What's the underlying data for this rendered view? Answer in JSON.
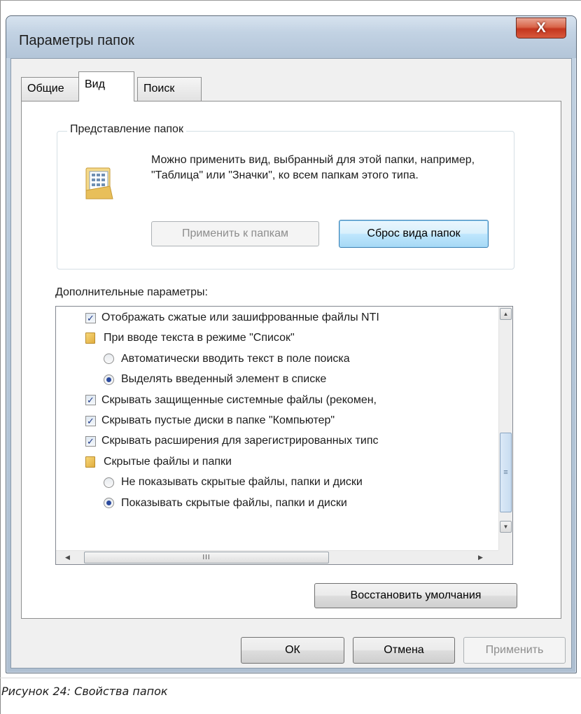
{
  "window": {
    "title": "Параметры папок",
    "close_glyph": "X"
  },
  "tabs": [
    {
      "label": "Общие",
      "active": false
    },
    {
      "label": "Вид",
      "active": true
    },
    {
      "label": "Поиск",
      "active": false
    }
  ],
  "folder_views": {
    "group_title": "Представление папок",
    "description": "Можно применить вид, выбранный для этой папки, например, \"Таблица\" или \"Значки\", ко всем папкам этого типа.",
    "apply_button": "Применить к папкам",
    "reset_button": "Сброс вида папок",
    "icon": "folder-view-icon"
  },
  "advanced": {
    "label": "Дополнительные параметры:",
    "items": [
      {
        "type": "checkbox",
        "checked": true,
        "indent": 0,
        "text": "Отображать сжатые или зашифрованные файлы NTI"
      },
      {
        "type": "folder",
        "indent": 0,
        "text": "При вводе текста в режиме \"Список\""
      },
      {
        "type": "radio",
        "selected": false,
        "indent": 1,
        "text": "Автоматически вводить текст в поле поиска"
      },
      {
        "type": "radio",
        "selected": true,
        "indent": 1,
        "text": "Выделять введенный элемент в списке"
      },
      {
        "type": "checkbox",
        "checked": true,
        "indent": 0,
        "text": "Скрывать защищенные системные файлы (рекомен,"
      },
      {
        "type": "checkbox",
        "checked": true,
        "indent": 0,
        "text": "Скрывать пустые диски в папке \"Компьютер\""
      },
      {
        "type": "checkbox",
        "checked": true,
        "indent": 0,
        "text": "Скрывать расширения для зарегистрированных типс"
      },
      {
        "type": "folder",
        "indent": 0,
        "text": "Скрытые файлы и папки"
      },
      {
        "type": "radio",
        "selected": false,
        "indent": 1,
        "text": "Не показывать скрытые файлы, папки и диски"
      },
      {
        "type": "radio",
        "selected": true,
        "indent": 1,
        "text": "Показывать скрытые файлы, папки и диски"
      }
    ],
    "scroll_grip": "≡",
    "hscroll_grip": "III"
  },
  "restore_button": "Восстановить умолчания",
  "footer": {
    "ok": "ОК",
    "cancel": "Отмена",
    "apply": "Применить"
  },
  "caption": "Рисунок 24: Свойства папок",
  "colors": {
    "accent_focus": "#3c7fb1",
    "close_red": "#c4361e",
    "check_mark": "#1f3a8a"
  }
}
